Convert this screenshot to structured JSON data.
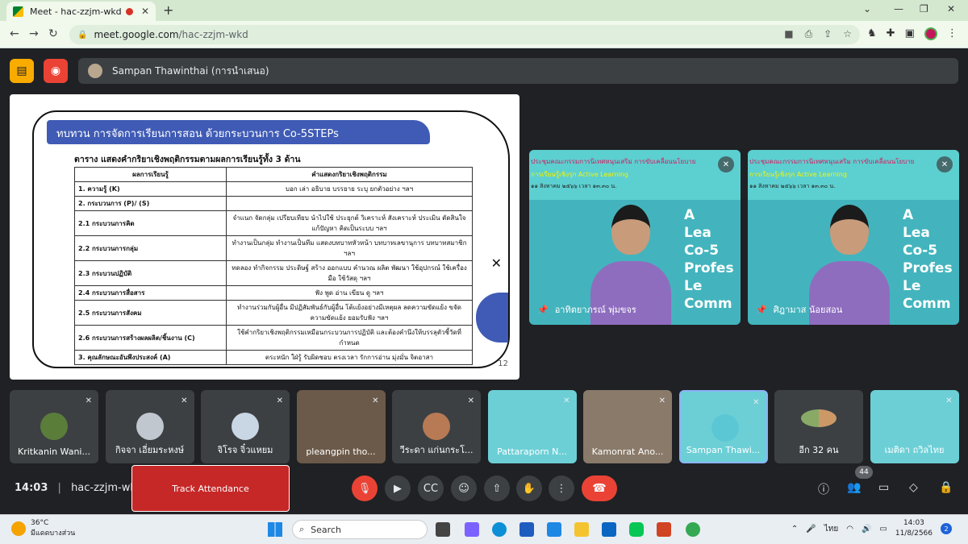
{
  "browser": {
    "tab_title": "Meet - hac-zzjm-wkd",
    "url_host": "meet.google.com",
    "url_path": "/hac-zzjm-wkd"
  },
  "meet": {
    "presenter_label": "Sampan Thawinthai (การนำเสนอ)",
    "meeting_code": "hac-zzjm-wkd",
    "time": "14:03",
    "track_attendance": "Track Attendance",
    "participants_count": "44"
  },
  "slide": {
    "banner": "ทบทวน การจัดการเรียนการสอน ด้วยกระบวนการ Co-5STEPs",
    "subtitle": "ตาราง แสดงคำกริยาเชิงพฤติกรรมตามผลการเรียนรู้ทั้ง 3 ด้าน",
    "col1": "ผลการเรียนรู้",
    "col2": "คำแสดงกริยาเชิงพฤติกรรม",
    "rows": [
      {
        "a": "1. ความรู้ (K)",
        "b": "บอก เล่า อธิบาย บรรยาย ระบุ ยกตัวอย่าง ฯลฯ"
      },
      {
        "a": "2. กระบวนการ (P)/ (S)",
        "b": ""
      },
      {
        "a": "2.1 กระบวนการคิด",
        "b": "จำแนก จัดกลุ่ม เปรียบเทียบ นำไปใช้ ประยุกต์ วิเคราะห์ สังเคราะห์ ประเมิน ตัดสินใจ แก้ปัญหา คิดเป็นระบบ ฯลฯ"
      },
      {
        "a": "2.2 กระบวนการกลุ่ม",
        "b": "ทำงานเป็นกลุ่ม ทำงานเป็นทีม แสดงบทบาทหัวหน้า บทบาทเลขานุการ บทบาทสมาชิก ฯลฯ"
      },
      {
        "a": "2.3 กระบวนปฏิบัติ",
        "b": "ทดลอง ทำกิจกรรม ประดิษฐ์ สร้าง ออกแบบ คำนวณ ผลิต พัฒนา ใช้อุปกรณ์ ใช้เครื่องมือ ใช้วัสดุ ฯลฯ"
      },
      {
        "a": "2.4 กระบวนการสื่อสาร",
        "b": "ฟัง พูด อ่าน เขียน ดู ฯลฯ"
      },
      {
        "a": "2.5 กระบวนการสังคม",
        "b": "ทำงานร่วมกับผู้อื่น มีปฏิสัมพันธ์กับผู้อื่น โต้แย้งอย่างมีเหตุผล ลดความขัดแย้ง ขจัดความขัดแย้ง ยอมรับฟัง ฯลฯ"
      },
      {
        "a": "2.6 กระบวนการสร้างผลผลิต/ชิ้นงาน (C)",
        "b": "ใช้คำกริยาเชิงพฤติกรรมเหมือนกระบวนการปฏิบัติ และต้องคำนึงให้บรรลุตัวชี้วัดที่กำหนด"
      },
      {
        "a": "3. คุณลักษณะอันพึงประสงค์ (A)",
        "b": "ตระหนัก ใฝ่รู้ รับผิดชอบ ตรงเวลา รักการอ่าน มุ่งมั่น จิตอาสา"
      }
    ],
    "page": "12"
  },
  "tile_header": {
    "line1": "ประชุมคณะกรรมการนิเทศหนุนเสริม",
    "line1_hl": "การขับเคลื่อนนโยบาย",
    "line2": "การเรียนรู้เชิงรุก Active Learning",
    "line3": "๑๑ สิงหาคม ๒๕๖๖ เวลา ๑๓.๓๐ น."
  },
  "tile_bigtext": [
    "A",
    "Lea",
    "Co-5",
    "Profes",
    "Le",
    "Comm"
  ],
  "big_tiles": [
    {
      "name": "อาทิตยาภรณ์ พุ่มขจร"
    },
    {
      "name": "ศิฎามาส น้อยสอน"
    }
  ],
  "strip": [
    {
      "name": "Kritkanin Wani..."
    },
    {
      "name": "กิจจา เอี่ยมระหงษ์"
    },
    {
      "name": "จิโรจ จิ๋วแหยม"
    },
    {
      "name": "pleangpin tho..."
    },
    {
      "name": "วีระดา แก่นกระโ..."
    },
    {
      "name": "Pattaraporn N..."
    },
    {
      "name": "Kamonrat Ano..."
    },
    {
      "name": "Sampan Thawi..."
    },
    {
      "name": "อีก 32 คน"
    },
    {
      "name": "เมติดา ถวิลไทย"
    }
  ],
  "taskbar": {
    "temp": "36°C",
    "weather": "มีแดดบางส่วน",
    "search": "Search",
    "lang": "ไทย",
    "time": "14:03",
    "date": "11/8/2566",
    "notif": "2"
  }
}
